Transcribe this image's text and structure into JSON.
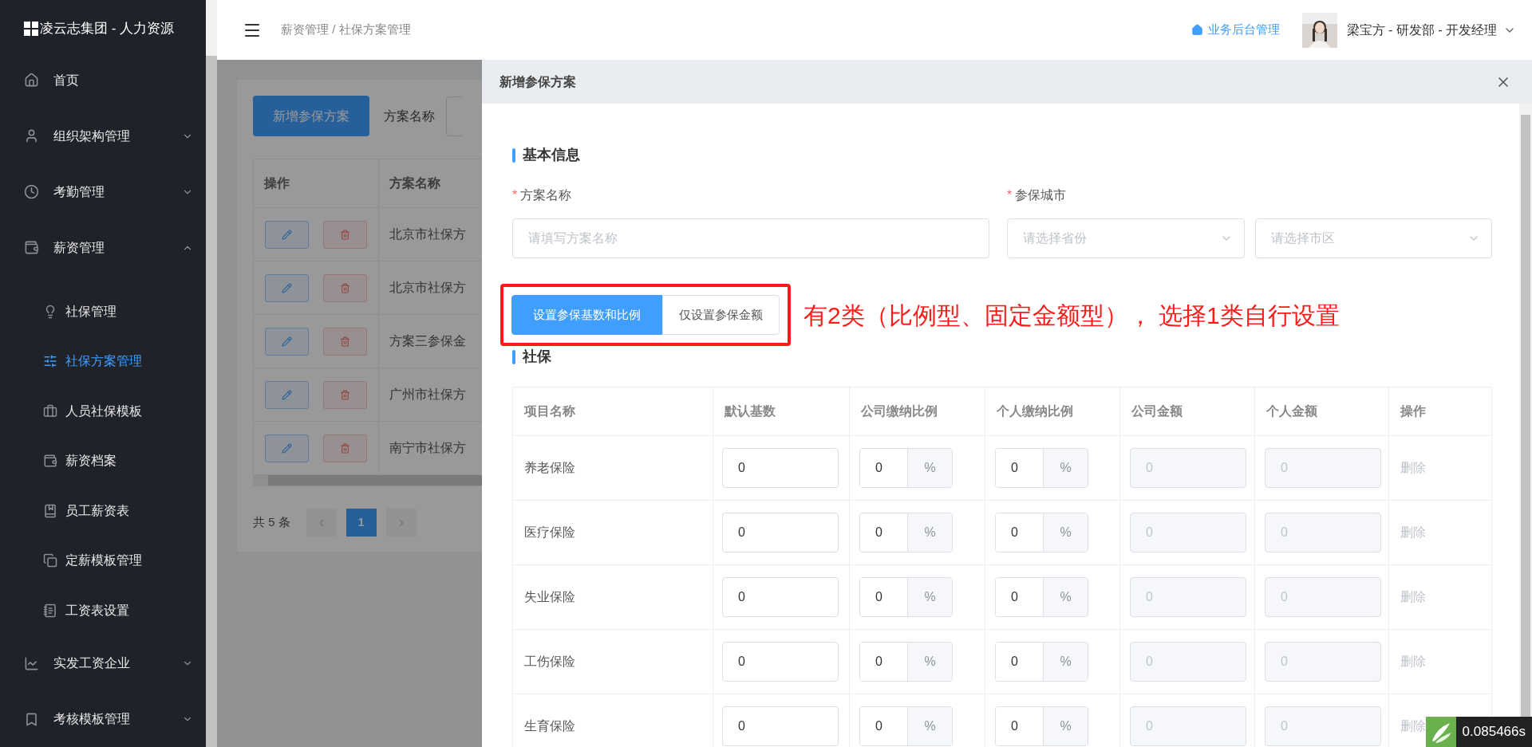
{
  "sidebar": {
    "logo": "凌云志集团 - 人力资源",
    "items": [
      {
        "label": "首页",
        "selected": false
      },
      {
        "label": "组织架构管理",
        "selected": false,
        "expanded": false
      },
      {
        "label": "考勤管理",
        "selected": false,
        "expanded": false
      },
      {
        "label": "薪资管理",
        "selected": false,
        "expanded": true,
        "children": [
          {
            "label": "社保管理",
            "selected": false
          },
          {
            "label": "社保方案管理",
            "selected": true
          },
          {
            "label": "人员社保模板",
            "selected": false
          },
          {
            "label": "薪资档案",
            "selected": false
          },
          {
            "label": "员工薪资表",
            "selected": false
          },
          {
            "label": "定薪模板管理",
            "selected": false
          },
          {
            "label": "工资表设置",
            "selected": false
          }
        ]
      },
      {
        "label": "实发工资企业",
        "selected": false,
        "expanded": false
      },
      {
        "label": "考核模板管理",
        "selected": false,
        "expanded": false
      }
    ]
  },
  "header": {
    "breadcrumb": "薪资管理 / 社保方案管理",
    "home_link": "业务后台管理",
    "user": "梁宝方 - 研发部 - 开发经理"
  },
  "page": {
    "add_button": "新增参保方案",
    "filter_label": "方案名称",
    "table": {
      "columns": [
        "操作",
        "方案名称"
      ],
      "rows": [
        {
          "name": "北京市社保方"
        },
        {
          "name": "北京市社保方"
        },
        {
          "name": "方案三参保金"
        },
        {
          "name": "广州市社保方"
        },
        {
          "name": "南宁市社保方"
        }
      ]
    },
    "pagination": {
      "total": "共 5 条",
      "pages": [
        {
          "label": "1",
          "selected": true
        }
      ]
    }
  },
  "drawer": {
    "title": "新增参保方案",
    "section_basic": "基本信息",
    "name_field": {
      "required_mark": "*",
      "label": "方案名称",
      "placeholder": "请填写方案名称"
    },
    "city_field": {
      "required_mark": "*",
      "label": "参保城市",
      "selects": [
        {
          "placeholder": "请选择省份"
        },
        {
          "placeholder": "请选择市区"
        }
      ]
    },
    "mode_tabs": [
      {
        "label": "设置参保基数和比例",
        "selected": true
      },
      {
        "label": "仅设置参保金额",
        "selected": false
      }
    ],
    "annotation": "有2类（比例型、固定金额型）， 选择1类自行设置",
    "section_social": "社保",
    "table": {
      "columns": [
        "项目名称",
        "默认基数",
        "公司缴纳比例",
        "个人缴纳比例",
        "公司金额",
        "个人金额",
        "操作"
      ],
      "rows": [
        {
          "name": "养老保险",
          "base": "0",
          "company_ratio": "0",
          "company_unit": "%",
          "personal_ratio": "0",
          "personal_unit": "%",
          "company_amount": "0",
          "personal_amount": "0",
          "amounts_disabled": true,
          "action": "删除",
          "action_disabled": true
        },
        {
          "name": "医疗保险",
          "base": "0",
          "company_ratio": "0",
          "company_unit": "%",
          "personal_ratio": "0",
          "personal_unit": "%",
          "company_amount": "0",
          "personal_amount": "0",
          "amounts_disabled": true,
          "action": "删除",
          "action_disabled": true
        },
        {
          "name": "失业保险",
          "base": "0",
          "company_ratio": "0",
          "company_unit": "%",
          "personal_ratio": "0",
          "personal_unit": "%",
          "company_amount": "0",
          "personal_amount": "0",
          "amounts_disabled": true,
          "action": "删除",
          "action_disabled": true
        },
        {
          "name": "工伤保险",
          "base": "0",
          "company_ratio": "0",
          "company_unit": "%",
          "personal_ratio": "0",
          "personal_unit": "%",
          "company_amount": "0",
          "personal_amount": "0",
          "amounts_disabled": true,
          "action": "删除",
          "action_disabled": true
        },
        {
          "name": "生育保险",
          "base": "0",
          "company_ratio": "0",
          "company_unit": "%",
          "personal_ratio": "0",
          "personal_unit": "%",
          "company_amount": "0",
          "personal_amount": "0",
          "amounts_disabled": true,
          "action": "删除",
          "action_disabled": true
        }
      ]
    }
  },
  "timer_badge": "0.085466s"
}
